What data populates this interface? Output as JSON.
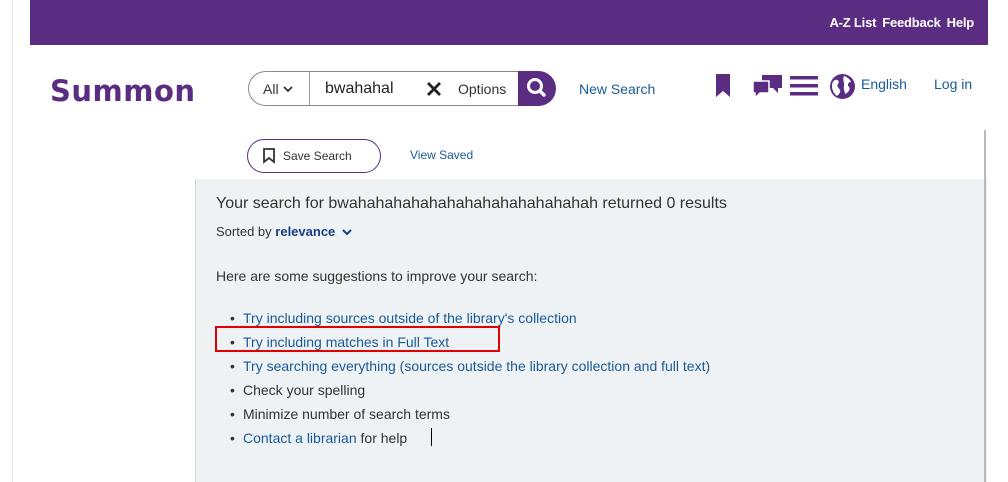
{
  "topbar": {
    "links": [
      "A-Z List",
      "Feedback",
      "Help"
    ],
    "background": "#5a2d82"
  },
  "header": {
    "logo": "Summon",
    "scope_value": "All",
    "query": "bwahahal",
    "clear_icon": "close-icon",
    "options_label": "Options",
    "new_search_label": "New Search",
    "language_label": "English",
    "login_label": "Log in"
  },
  "actions": {
    "save_search_label": "Save Search",
    "view_saved_label": "View Saved"
  },
  "results": {
    "summary": "Your search for bwahahahahahahahahahahahahahah returned 0 results",
    "sorted_prefix": "Sorted by",
    "sort_value": "relevance",
    "suggestions_intro": "Here are some suggestions to improve your search:",
    "suggestions": [
      {
        "link": "Try including sources outside of the library's collection",
        "rest": ""
      },
      {
        "link": "Try including matches in Full Text",
        "rest": ""
      },
      {
        "link": "Try searching everything (sources outside the library collection and full text)",
        "rest": ""
      },
      {
        "link": "",
        "rest": "Check your spelling"
      },
      {
        "link": "",
        "rest": "Minimize number of search terms"
      },
      {
        "link": "Contact a librarian",
        "rest": " for help"
      }
    ]
  },
  "colors": {
    "brand": "#5a2d82",
    "link": "#1a5b96",
    "highlight": "#e00000",
    "panel": "#eef2f5"
  }
}
